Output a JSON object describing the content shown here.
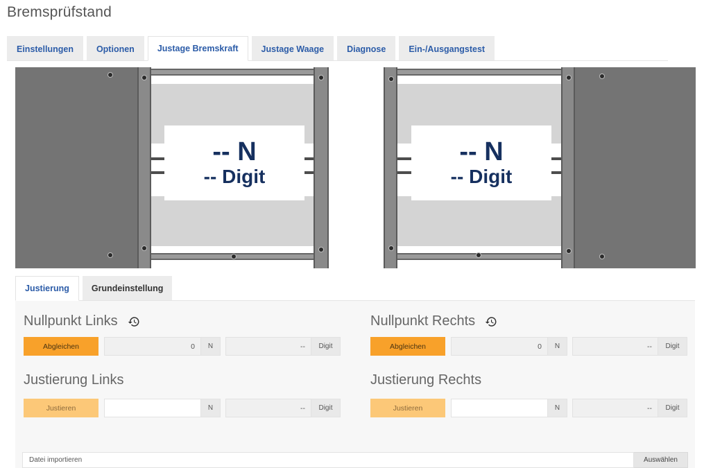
{
  "page": {
    "title": "Bremsprüfstand"
  },
  "tabs": [
    {
      "label": "Einstellungen"
    },
    {
      "label": "Optionen"
    },
    {
      "label": "Justage Bremskraft"
    },
    {
      "label": "Justage Waage"
    },
    {
      "label": "Diagnose"
    },
    {
      "label": "Ein-/Ausgangstest"
    }
  ],
  "active_tab": "Justage Bremskraft",
  "machines": {
    "left": {
      "force": "-- N",
      "digit": "-- Digit"
    },
    "right": {
      "force": "-- N",
      "digit": "-- Digit"
    }
  },
  "subtabs": [
    {
      "label": "Justierung"
    },
    {
      "label": "Grundeinstellung"
    }
  ],
  "active_subtab": "Justierung",
  "nullpunkt": {
    "left": {
      "title": "Nullpunkt Links",
      "button": "Abgleichen",
      "force_value": "0",
      "force_unit": "N",
      "digit_value": "--",
      "digit_unit": "Digit"
    },
    "right": {
      "title": "Nullpunkt Rechts",
      "button": "Abgleichen",
      "force_value": "0",
      "force_unit": "N",
      "digit_value": "--",
      "digit_unit": "Digit"
    }
  },
  "justierung": {
    "left": {
      "title": "Justierung Links",
      "button": "Justieren",
      "force_value": "",
      "force_unit": "N",
      "digit_value": "--",
      "digit_unit": "Digit"
    },
    "right": {
      "title": "Justierung Rechts",
      "button": "Justieren",
      "force_value": "",
      "force_unit": "N",
      "digit_value": "--",
      "digit_unit": "Digit"
    }
  },
  "file_import": {
    "placeholder": "Datei importieren",
    "button": "Auswählen"
  },
  "colors": {
    "accent": "#f8a12a",
    "accent_disabled": "#fcc878",
    "link": "#2c5ca8",
    "readout": "#16305f"
  },
  "icons": {
    "history": "history-icon"
  }
}
